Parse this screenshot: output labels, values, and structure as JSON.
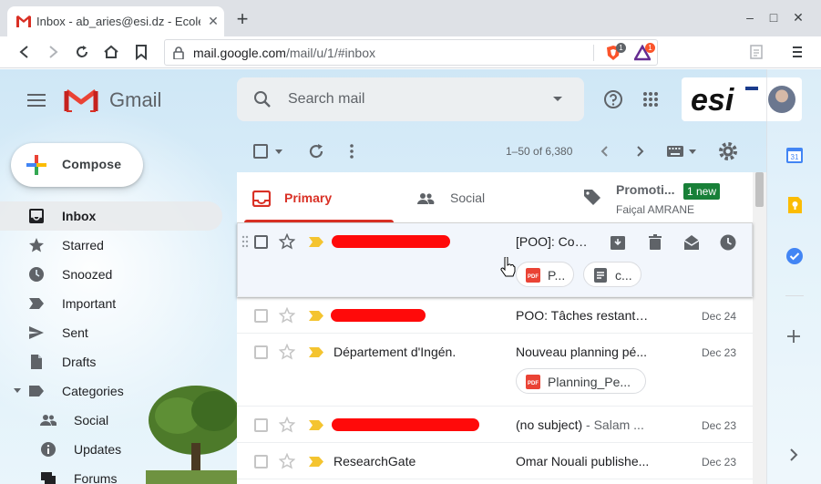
{
  "browser": {
    "tab_title": "Inbox - ab_aries@esi.dz - Ecole",
    "tab_close": "✕",
    "new_tab": "+",
    "url_host": "mail.google.com",
    "url_path": "/mail/u/1/#inbox",
    "brave_badge": "1",
    "rewards_badge": "1",
    "window_controls": {
      "minimize": "–",
      "maximize": "□",
      "close": "✕"
    }
  },
  "gmail": {
    "brand": "Gmail",
    "search_placeholder": "Search mail",
    "account_logo": "esi",
    "compose_label": "Compose",
    "nav": [
      {
        "label": "Inbox",
        "icon": "inbox-icon",
        "active": true
      },
      {
        "label": "Starred",
        "icon": "star-icon"
      },
      {
        "label": "Snoozed",
        "icon": "clock-icon"
      },
      {
        "label": "Important",
        "icon": "important-icon"
      },
      {
        "label": "Sent",
        "icon": "send-icon"
      },
      {
        "label": "Drafts",
        "icon": "draft-icon"
      },
      {
        "label": "Categories",
        "icon": "label-icon"
      },
      {
        "label": "Social",
        "icon": "people-icon"
      },
      {
        "label": "Updates",
        "icon": "info-icon"
      },
      {
        "label": "Forums",
        "icon": "forum-icon"
      }
    ],
    "toolbar": {
      "range": "1–50 of 6,380"
    },
    "tabs": [
      {
        "label": "Primary",
        "icon": "inbox-tab-icon",
        "active": true
      },
      {
        "label": "Social",
        "icon": "people-icon"
      },
      {
        "label": "Promoti...",
        "icon": "tag-icon",
        "badge": "1 new",
        "sub": "Faiçal AMRANE"
      }
    ],
    "emails": [
      {
        "sender": "",
        "subject": "[POO]: Cou...",
        "snippet": "",
        "date": "",
        "attachments": [
          "P...",
          "c..."
        ]
      },
      {
        "sender": "",
        "subject": "POO: Tâches restante...",
        "snippet": "",
        "date": "Dec 24"
      },
      {
        "sender": "Département d'Ingén.",
        "subject": "Nouveau planning pé...",
        "snippet": "",
        "date": "Dec 23",
        "attachments": [
          "Planning_Pe..."
        ]
      },
      {
        "sender": "",
        "subject": "(no subject)",
        "snippet": " - Salam ...",
        "date": "Dec 23"
      },
      {
        "sender": "ResearchGate",
        "subject": "Omar Nouali publishe...",
        "snippet": "",
        "date": "Dec 23"
      }
    ]
  },
  "colors": {
    "accent": "#d93025",
    "new_badge": "#188038",
    "redaction": "#ff0a0a",
    "important_marker": "#f4c430"
  }
}
